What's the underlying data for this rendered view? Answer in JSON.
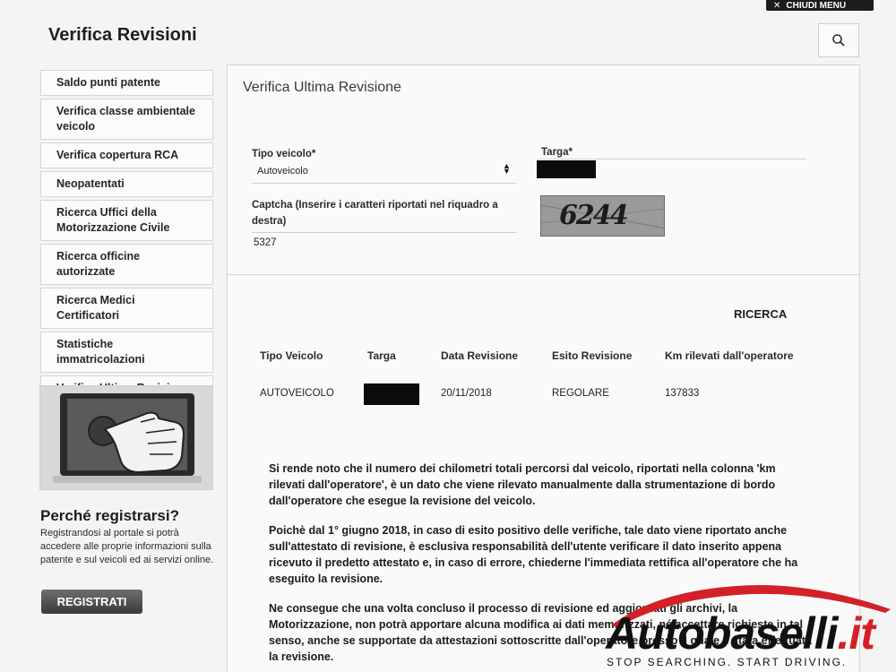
{
  "header": {
    "close_menu_label": "CHIUDI MENU",
    "page_title": "Verifica Revisioni"
  },
  "sidebar": {
    "items": [
      {
        "label": "Saldo punti patente"
      },
      {
        "label": "Verifica classe ambientale veicolo"
      },
      {
        "label": "Verifica copertura RCA"
      },
      {
        "label": "Neopatentati"
      },
      {
        "label": "Ricerca Uffici della Motorizzazione Civile"
      },
      {
        "label": "Ricerca officine autorizzate"
      },
      {
        "label": "Ricerca Medici Certificatori"
      },
      {
        "label": "Statistiche immatricolazioni"
      },
      {
        "label": "Verifica Ultima Revisione",
        "active": true
      }
    ]
  },
  "promo": {
    "title": "Perché registrarsi?",
    "text": "Registrandosi al portale si potrà accedere alle proprie informazioni sulla patente e sul veicoli ed ai servizi online.",
    "button_label": "REGISTRATI"
  },
  "form": {
    "title": "Verifica Ultima Revisione",
    "vehicle_type_label": "Tipo veicolo*",
    "vehicle_type_value": "Autoveicolo",
    "plate_label": "Targa*",
    "captcha_label": "Captcha (Inserire i caratteri riportati nel riquadro a destra)",
    "captcha_value": "5327",
    "captcha_image_text": "6244"
  },
  "results": {
    "search_label": "RICERCA",
    "columns": [
      "Tipo Veicolo",
      "Targa",
      "Data Revisione",
      "Esito Revisione",
      "Km rilevati dall'operatore"
    ],
    "row": {
      "vehicle_type": "AUTOVEICOLO",
      "date": "20/11/2018",
      "outcome": "REGOLARE",
      "km": "137833"
    }
  },
  "notes": {
    "p1": "Si rende noto che il numero dei chilometri totali percorsi dal veicolo, riportati nella colonna 'km rilevati dall'operatore', è un dato che viene rilevato manualmente dalla strumentazione di bordo dall'operatore che esegue la revisione del veicolo.",
    "p2": "Poichè dal 1° giugno 2018, in caso di esito positivo delle verifiche, tale dato viene riportato anche sull'attestato di revisione, è esclusiva responsabilità dell'utente verificare il dato inserito appena ricevuto il predetto attestato e, in caso di errore, chiederne l'immediata rettifica all'operatore che ha eseguito la revisione.",
    "p3": "Ne consegue che una volta concluso il processo di revisione ed aggiornati gli archivi, la Motorizzazione, non potrà apportare alcuna modifica ai dati memorizzati, né accettare richieste in tal senso, anche se supportate da attestazioni sottoscritte dall'operatore presso il quale è stata effettuata la revisione."
  },
  "watermark": {
    "brand_main": "Autobaselli",
    "brand_suffix": ".it",
    "slogan": "STOP SEARCHING. START DRIVING."
  },
  "colors": {
    "brand_red": "#d42027",
    "text_dark": "#1a1a1a",
    "border": "#d3d3d3"
  }
}
